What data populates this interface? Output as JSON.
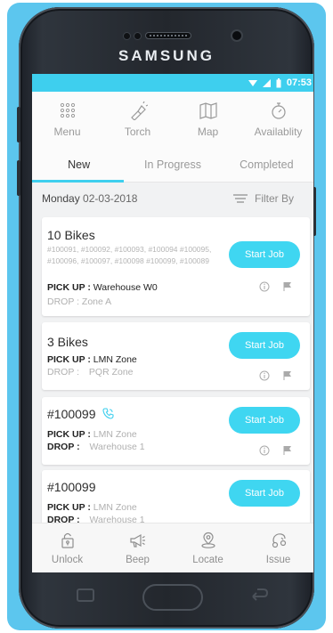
{
  "device": {
    "brand": "SAMSUNG"
  },
  "status_bar": {
    "time": "07:53",
    "accent": "#3ecfee"
  },
  "toolbar": {
    "items": [
      {
        "label": "Menu",
        "icon": "grid-dots-icon"
      },
      {
        "label": "Torch",
        "icon": "torch-icon"
      },
      {
        "label": "Map",
        "icon": "map-icon"
      },
      {
        "label": "Availablity",
        "icon": "stopwatch-icon"
      }
    ]
  },
  "tabs": [
    {
      "label": "New",
      "active": true
    },
    {
      "label": "In Progress",
      "active": false
    },
    {
      "label": "Completed",
      "active": false
    }
  ],
  "filter": {
    "day": "Monday",
    "date": "02-03-2018",
    "filter_label": "Filter By"
  },
  "jobs": [
    {
      "title": "10 Bikes",
      "ids": "#100091, #100092, #100093, #100094 #100095, #100096, #100097, #100098 #100099, #100089",
      "pickup_label": "PICK UP :",
      "pickup_value": "Warehouse W0",
      "drop_label": "DROP :",
      "drop_value": "Zone A",
      "button": "Start Job"
    },
    {
      "title": "3 Bikes",
      "pickup_label": "PICK UP :",
      "pickup_value": "LMN Zone",
      "drop_label": "DROP :",
      "drop_value": "PQR Zone",
      "button": "Start Job"
    },
    {
      "title": "#100099",
      "pickup_label": "PICK UP :",
      "pickup_value": "LMN Zone",
      "drop_label": "DROP :",
      "drop_value": "Warehouse 1",
      "button": "Start Job"
    },
    {
      "title": "#100099",
      "pickup_label": "PICK UP :",
      "pickup_value": "LMN Zone",
      "drop_label": "DROP :",
      "drop_value": "Warehouse 1",
      "button": "Start Job"
    }
  ],
  "bottom_nav": [
    {
      "label": "Unlock",
      "icon": "lock-icon"
    },
    {
      "label": "Beep",
      "icon": "megaphone-icon"
    },
    {
      "label": "Locate",
      "icon": "location-pin-icon"
    },
    {
      "label": "Issue",
      "icon": "bike-issue-icon"
    }
  ],
  "colors": {
    "frame": "#5cc6ee",
    "button": "#3fd6f1",
    "phone": "#23272d"
  }
}
